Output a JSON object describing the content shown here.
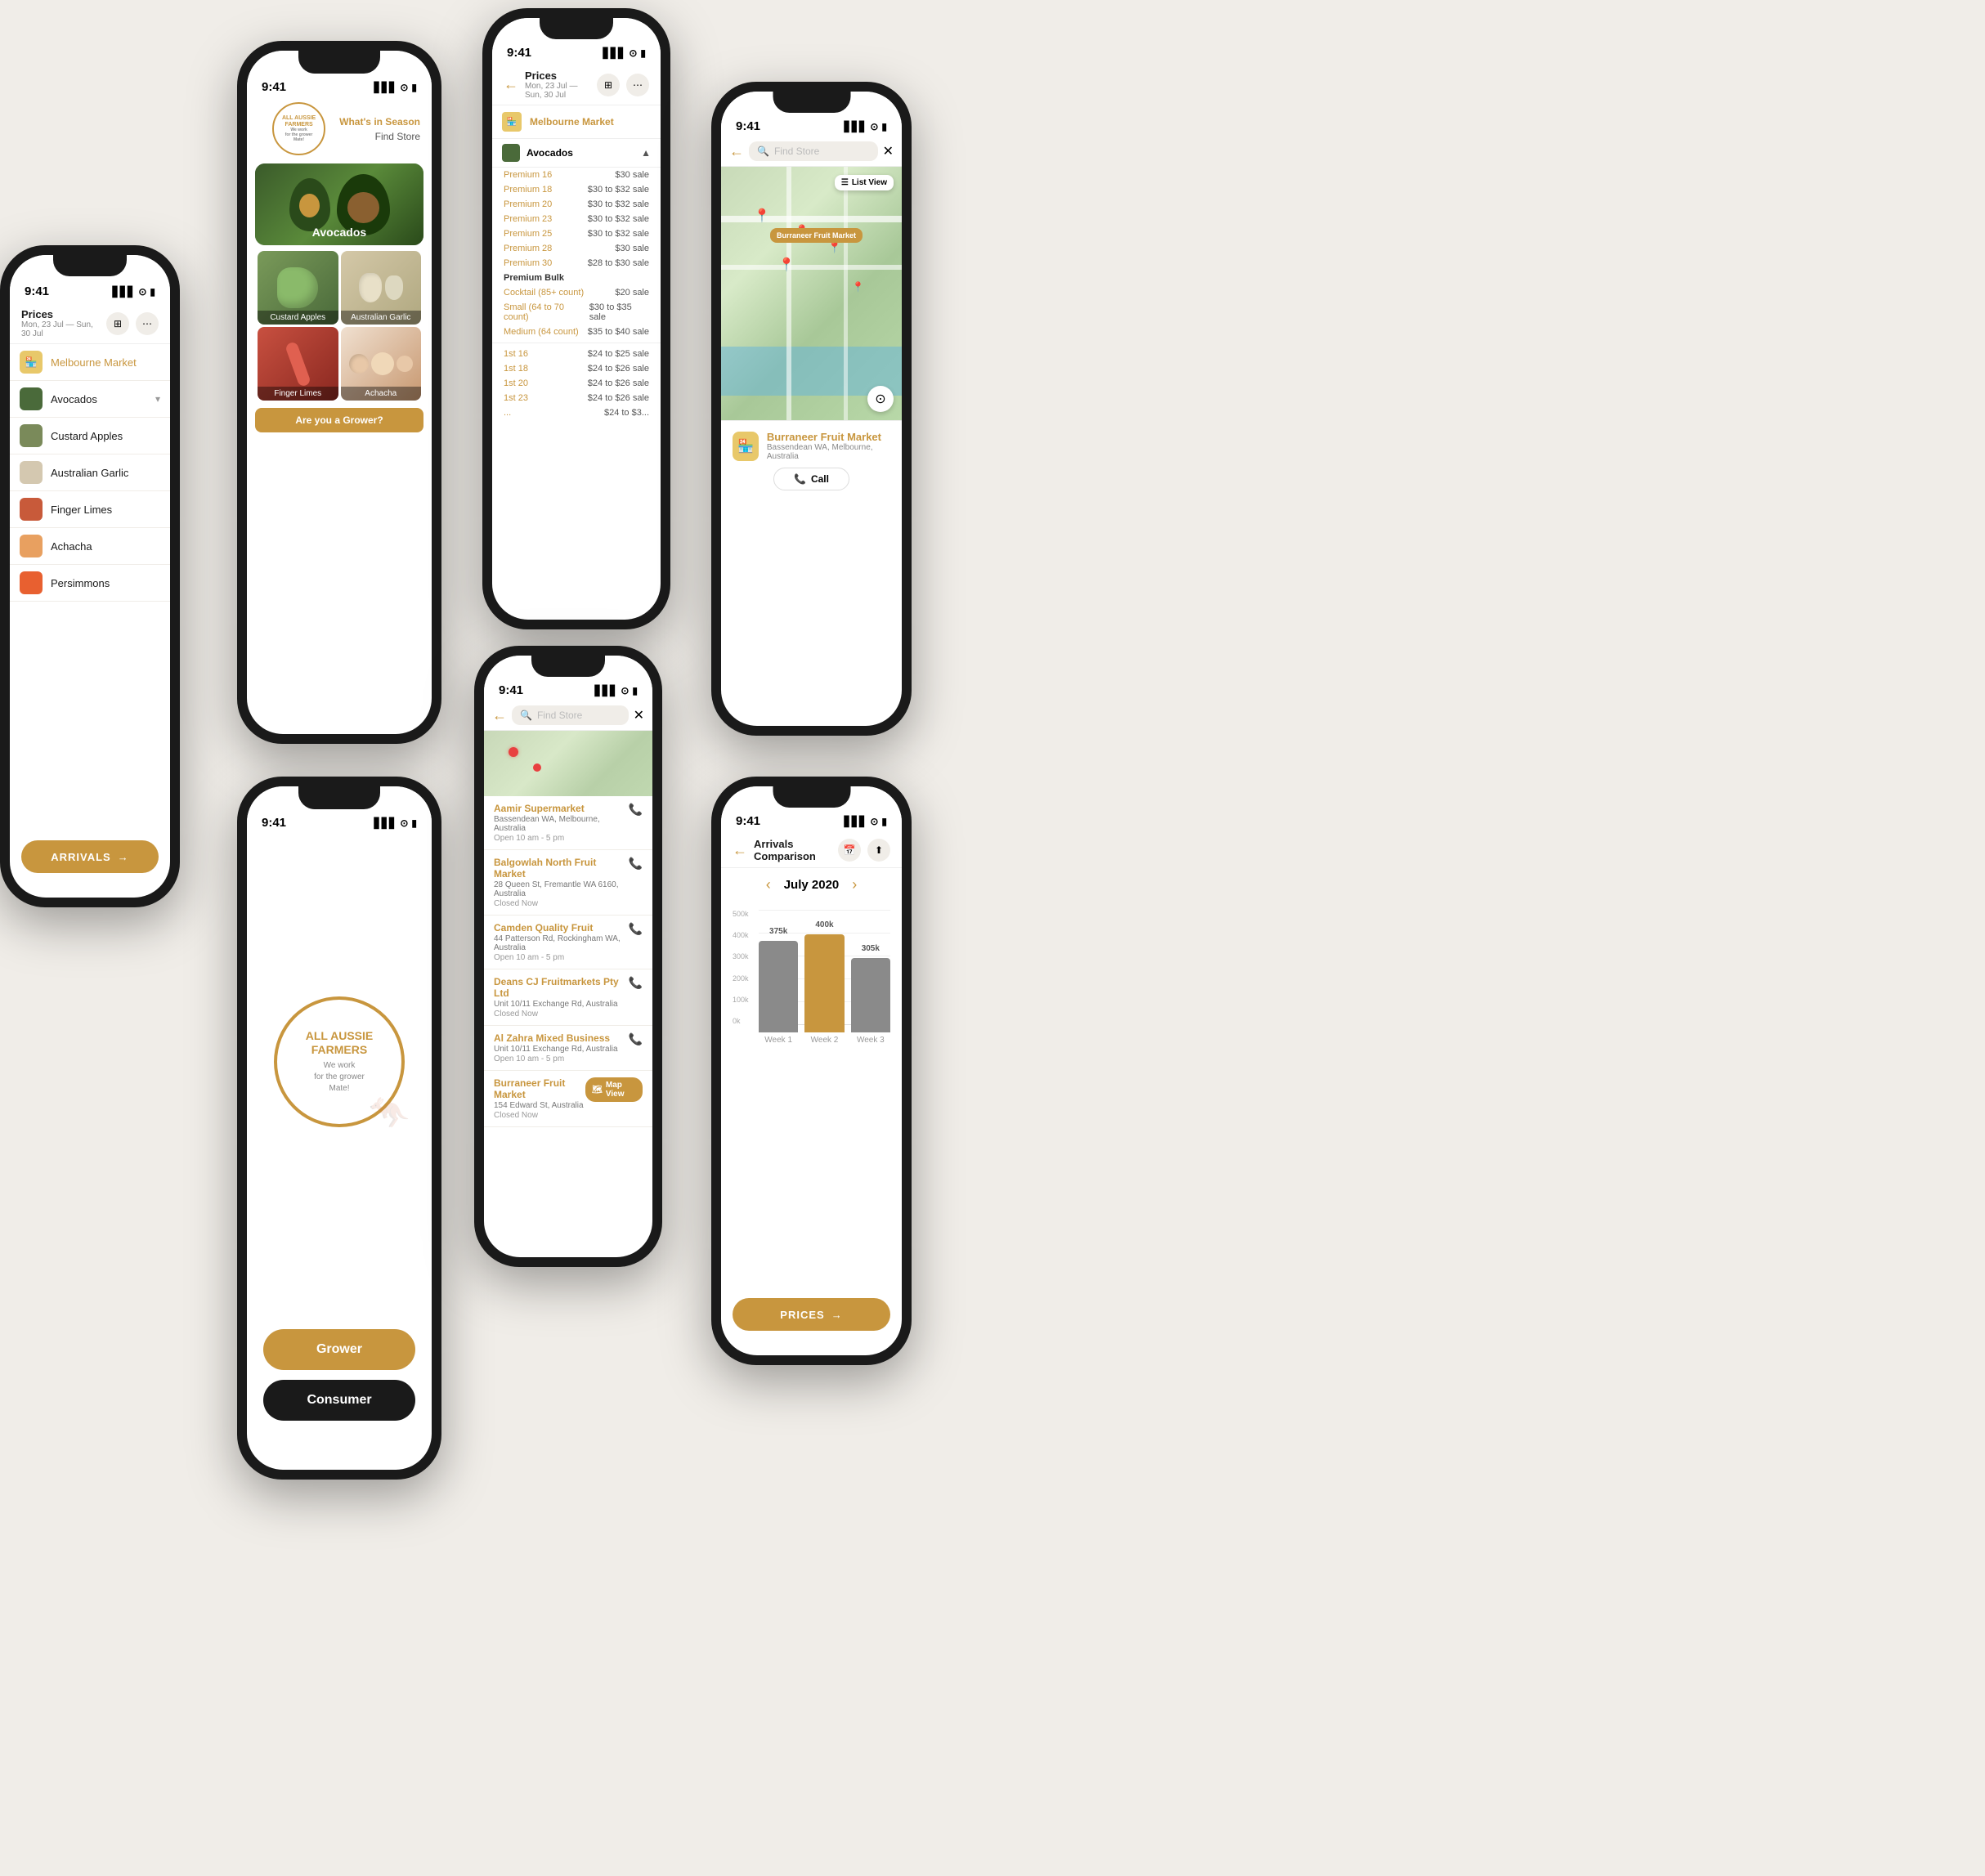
{
  "app": {
    "name": "All Aussie Farmers",
    "logo_text": "ALL AUSSIE\nFARMERS\nWe work\nfor the grower\nMate!"
  },
  "phone1": {
    "status_time": "9:41",
    "title": "Prices",
    "date_range": "Mon, 23 Jul — Sun, 30 Jul",
    "market": "Melbourne Market",
    "produce_items": [
      {
        "name": "Avocados"
      },
      {
        "name": "Custard Apples"
      },
      {
        "name": "Australian Garlic"
      },
      {
        "name": "Finger Limes"
      },
      {
        "name": "Achacha"
      },
      {
        "name": "Persimmons"
      }
    ],
    "arrivals_btn": "ARRIVALS"
  },
  "phone2": {
    "status_time": "9:41",
    "whats_in_season": "What's in Season",
    "find_store": "Find Store",
    "hero_title": "Avocados",
    "grid_items": [
      {
        "name": "Custard Apples"
      },
      {
        "name": "Australian Garlic"
      },
      {
        "name": "Finger Limes"
      },
      {
        "name": "Achacha"
      }
    ],
    "grower_cta": "Are you a Grower?"
  },
  "phone3": {
    "status_time": "9:41",
    "title": "Prices",
    "date_range": "Mon, 23 Jul — Sun, 30 Jul",
    "market": "Melbourne Market",
    "product": "Avocados",
    "price_rows": [
      {
        "label": "Premium 16",
        "value": "$30 sale"
      },
      {
        "label": "Premium 18",
        "value": "$30 to $32 sale"
      },
      {
        "label": "Premium 20",
        "value": "$30 to $32 sale"
      },
      {
        "label": "Premium 23",
        "value": "$30 to $32 sale"
      },
      {
        "label": "Premium 25",
        "value": "$30 to $32 sale"
      },
      {
        "label": "Premium 28",
        "value": "$30 sale"
      },
      {
        "label": "Premium 30",
        "value": "$28 to $30 sale"
      },
      {
        "label": "Premium Bulk",
        "value": ""
      },
      {
        "label": "Cocktail (85+ count)",
        "value": "$20 sale"
      },
      {
        "label": "Small (64 to 70 count)",
        "value": "$30 to $35 sale"
      },
      {
        "label": "Medium (64 count)",
        "value": "$35 to $40 sale"
      },
      {
        "label": "1st 16",
        "value": "$24 to $25 sale"
      },
      {
        "label": "1st 18",
        "value": "$24 to $26 sale"
      },
      {
        "label": "1st 20",
        "value": "$24 to $26 sale"
      },
      {
        "label": "1st 23",
        "value": "$24 to $26 sale"
      },
      {
        "label": "...",
        "value": "$24 to $3..."
      }
    ]
  },
  "phone4": {
    "status_time": "9:41",
    "grower_btn": "Grower",
    "consumer_btn": "Consumer"
  },
  "phone5": {
    "status_time": "9:41",
    "search_placeholder": "Find Store",
    "stores": [
      {
        "name": "Aamir Supermarket",
        "addr": "Bassendean WA, Melbourne, Australia",
        "hours": "Open 10 am - 5 pm"
      },
      {
        "name": "Balgowlah North Fruit Market",
        "addr": "28 Queen St, Fremantle WA 6160, Australia",
        "hours": "Closed Now"
      },
      {
        "name": "Camden Quality Fruit",
        "addr": "44 Patterson Rd, Rockingham WA, Australia",
        "hours": "Open 10 am - 5 pm"
      },
      {
        "name": "Deans CJ Fruitmarkets Pty Ltd",
        "addr": "Unit 10/11 Exchange Rd, Australia",
        "hours": "Closed Now"
      },
      {
        "name": "Al Zahra Mixed Business",
        "addr": "Unit 10/11 Exchange Rd, Australia",
        "hours": "Open 10 am - 5 pm"
      },
      {
        "name": "Burraneer Fruit Market",
        "addr": "154 Edward St, Australia",
        "hours": "Closed Now"
      }
    ],
    "map_view_btn": "Map View"
  },
  "phone6": {
    "status_time": "9:41",
    "search_placeholder": "Find Store",
    "selected_store": "Burraneer Fruit Market",
    "selected_addr": "Bassendean WA, Melbourne, Australia",
    "list_view_btn": "List View",
    "call_btn": "Call"
  },
  "phone7": {
    "status_time": "9:41",
    "title": "Arrivals Comparison",
    "month": "July  2020",
    "y_labels": [
      "500k",
      "400k",
      "300k",
      "200k",
      "100k",
      "0k"
    ],
    "bars": [
      {
        "week": "Week 1",
        "value1": 375,
        "value2": 0,
        "label1": "375k",
        "color1": "#8a8a8a"
      },
      {
        "week": "Week 2",
        "value1": 400,
        "value2": 0,
        "label1": "400k",
        "color1": "#c8963e"
      },
      {
        "week": "Week 3",
        "value1": 305,
        "value2": 0,
        "label1": "305k",
        "color1": "#8a8a8a"
      }
    ],
    "prices_btn": "PRICES"
  },
  "colors": {
    "primary": "#c8963e",
    "dark": "#1a1a1a",
    "light_bg": "#f0ede8",
    "text_dark": "#1a1a1a",
    "text_mid": "#555",
    "text_light": "#999",
    "green_dark": "#5a7a3a",
    "bar_gold": "#c8963e",
    "bar_gray": "#8a8a8a"
  }
}
